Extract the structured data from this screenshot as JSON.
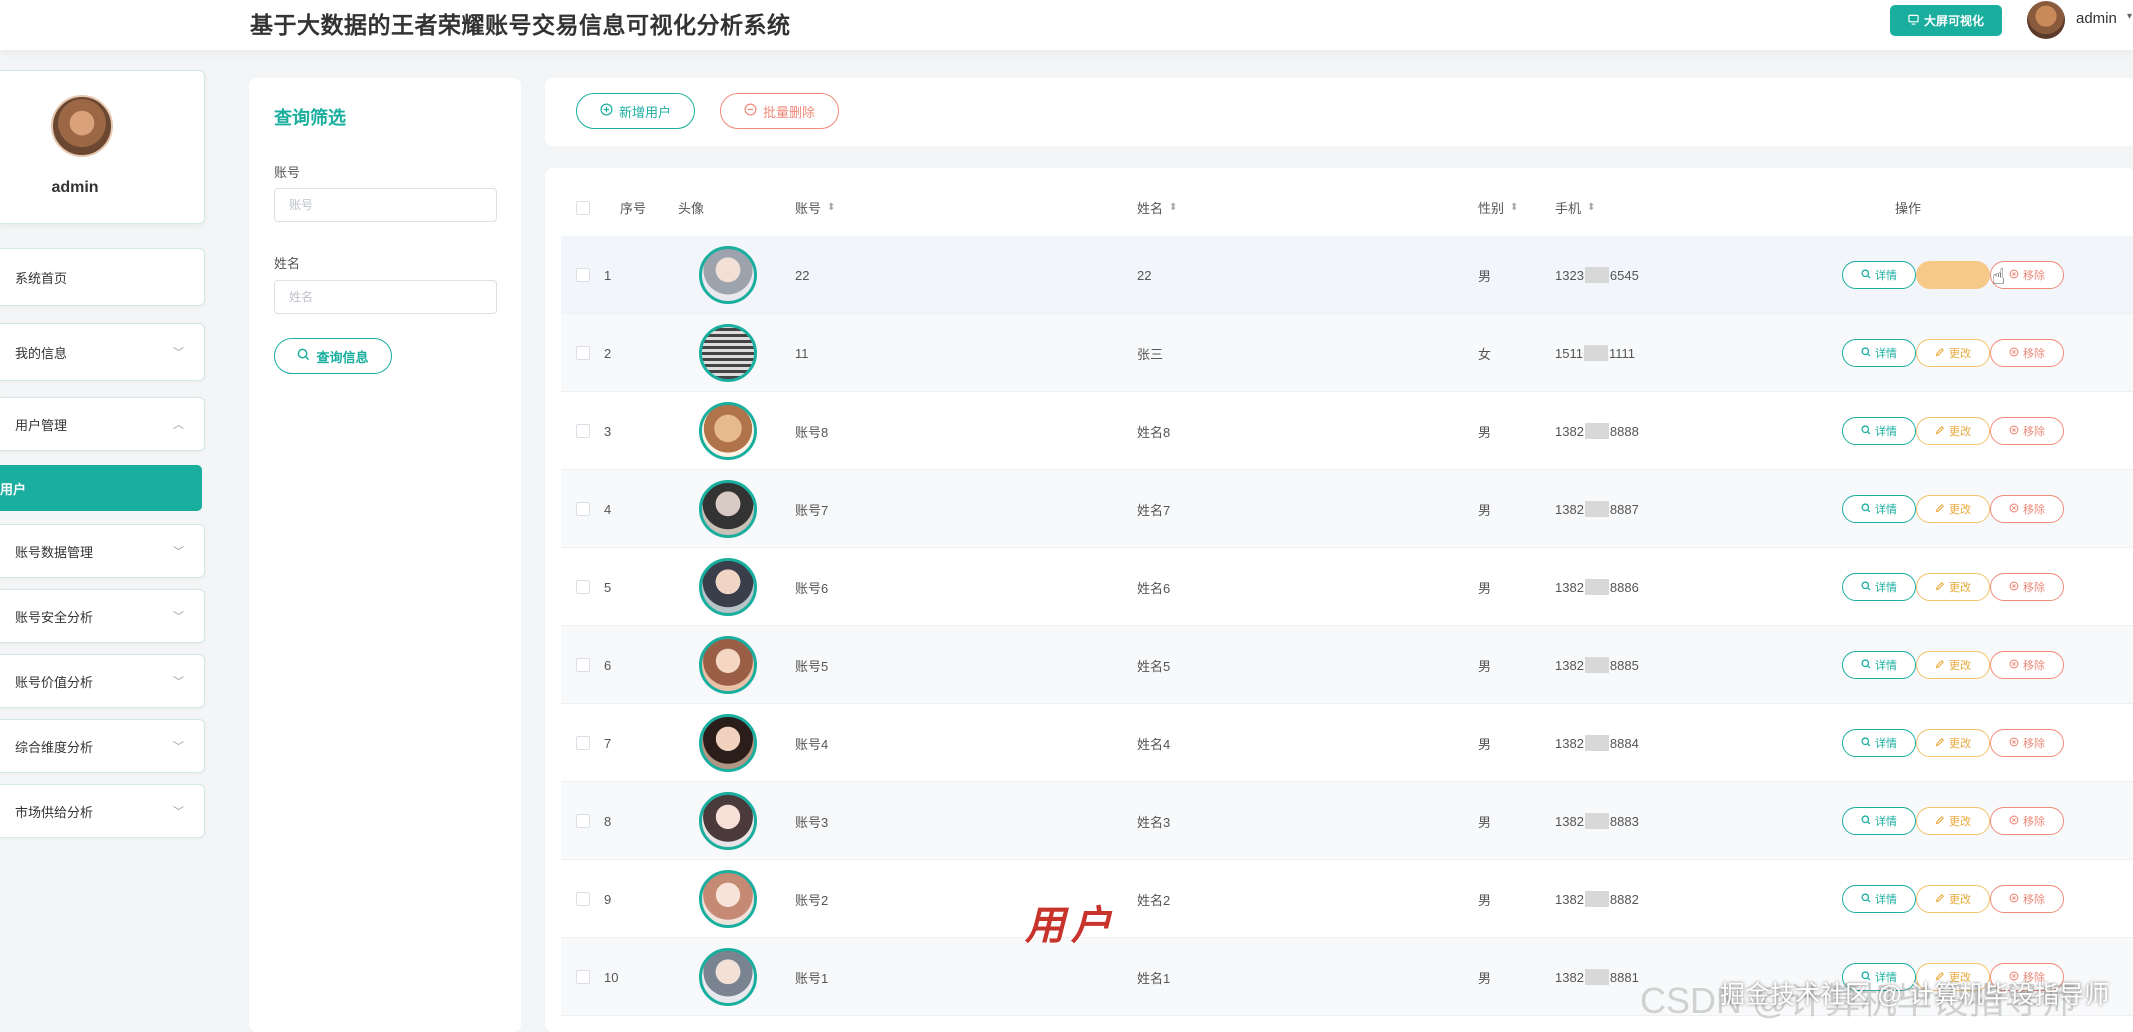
{
  "header": {
    "title": "基于大数据的王者荣耀账号交易信息可视化分析系统",
    "bigscreen_label": "大屏可视化",
    "username": "admin"
  },
  "sidebar": {
    "profile_name": "admin",
    "items": [
      {
        "label": "系统首页",
        "icon": ""
      },
      {
        "label": "我的信息",
        "icon": "chevron-down-icon"
      },
      {
        "label": "用户管理",
        "icon": "chevron-up-icon"
      },
      {
        "label": "用户",
        "icon": ""
      },
      {
        "label": "账号数据管理",
        "icon": "chevron-down-icon"
      },
      {
        "label": "账号安全分析",
        "icon": "chevron-down-icon"
      },
      {
        "label": "账号价值分析",
        "icon": "chevron-down-icon"
      },
      {
        "label": "综合维度分析",
        "icon": "chevron-down-icon"
      },
      {
        "label": "市场供给分析",
        "icon": "chevron-down-icon"
      }
    ]
  },
  "filter": {
    "title": "查询筛选",
    "account_label": "账号",
    "account_placeholder": "账号",
    "name_label": "姓名",
    "name_placeholder": "姓名",
    "search_label": "查询信息"
  },
  "toolbar": {
    "add_label": "新增用户",
    "batch_delete_label": "批量删除"
  },
  "table": {
    "headers": {
      "index": "序号",
      "avatar": "头像",
      "account": "账号",
      "name": "姓名",
      "gender": "性别",
      "phone": "手机",
      "actions": "操作"
    },
    "rows": [
      {
        "index": "1",
        "account": "22",
        "name": "22",
        "gender": "男",
        "phone_prefix": "1323",
        "phone_suffix": "6545"
      },
      {
        "index": "2",
        "account": "11",
        "name": "张三",
        "gender": "女",
        "phone_prefix": "1511",
        "phone_suffix": "1111"
      },
      {
        "index": "3",
        "account": "账号8",
        "name": "姓名8",
        "gender": "男",
        "phone_prefix": "1382",
        "phone_suffix": "8888"
      },
      {
        "index": "4",
        "account": "账号7",
        "name": "姓名7",
        "gender": "男",
        "phone_prefix": "1382",
        "phone_suffix": "8887"
      },
      {
        "index": "5",
        "account": "账号6",
        "name": "姓名6",
        "gender": "男",
        "phone_prefix": "1382",
        "phone_suffix": "8886"
      },
      {
        "index": "6",
        "account": "账号5",
        "name": "姓名5",
        "gender": "男",
        "phone_prefix": "1382",
        "phone_suffix": "8885"
      },
      {
        "index": "7",
        "account": "账号4",
        "name": "姓名4",
        "gender": "男",
        "phone_prefix": "1382",
        "phone_suffix": "8884"
      },
      {
        "index": "8",
        "account": "账号3",
        "name": "姓名3",
        "gender": "男",
        "phone_prefix": "1382",
        "phone_suffix": "8883"
      },
      {
        "index": "9",
        "account": "账号2",
        "name": "姓名2",
        "gender": "男",
        "phone_prefix": "1382",
        "phone_suffix": "8882"
      },
      {
        "index": "10",
        "account": "账号1",
        "name": "姓名1",
        "gender": "男",
        "phone_prefix": "1382",
        "phone_suffix": "8881"
      }
    ],
    "actions": {
      "detail": "详情",
      "edit": "更改",
      "remove": "移除"
    }
  },
  "overlay": {
    "caption": "用户",
    "watermark_bg": "CSDN @计算机毕设指导师",
    "watermark_fg": "掘金技术社区 @ 计算机毕设指导师"
  },
  "colors": {
    "accent": "#1aae9f",
    "danger": "#f08a7a",
    "warning": "#f3c26b"
  }
}
